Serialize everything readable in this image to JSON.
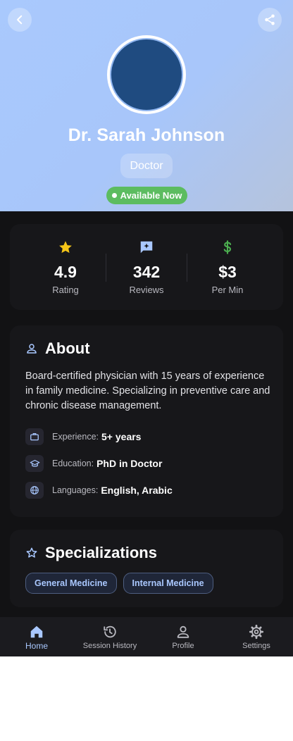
{
  "colors": {
    "header_gradient_start": "#a9c9fd",
    "header_gradient_end": "#b5c3dc",
    "avatar": "#1f4b80",
    "available": "#5cbc60",
    "star": "#f5c518",
    "dollar": "#4caf50",
    "accent": "#a9c8ff",
    "background": "#121214",
    "card": "#17171a"
  },
  "header": {
    "back_icon": "chevron-left-icon",
    "share_icon": "share-icon",
    "name": "Dr. Sarah Johnson",
    "role": "Doctor",
    "availability": "Available Now"
  },
  "stats": [
    {
      "icon": "star-icon",
      "value": "4.9",
      "label": "Rating"
    },
    {
      "icon": "review-icon",
      "value": "342",
      "label": "Reviews"
    },
    {
      "icon": "dollar-icon",
      "value": "$3",
      "label": "Per Min"
    }
  ],
  "about": {
    "icon": "person-icon",
    "title": "About",
    "text": "Board-certified physician with 15 years of experience in family medicine. Specializing in preventive care and chronic disease management.",
    "details": [
      {
        "icon": "briefcase-icon",
        "label": "Experience:",
        "value": "5+ years"
      },
      {
        "icon": "graduation-cap-icon",
        "label": "Education:",
        "value": "PhD in Doctor"
      },
      {
        "icon": "globe-icon",
        "label": "Languages:",
        "value": "English, Arabic"
      }
    ]
  },
  "specializations": {
    "icon": "star-outline-icon",
    "title": "Specializations",
    "items": [
      "General Medicine",
      "Internal Medicine"
    ]
  },
  "nav": {
    "items": [
      {
        "icon": "home-icon",
        "label": "Home",
        "active": true
      },
      {
        "icon": "history-icon",
        "label": "Session History",
        "active": false
      },
      {
        "icon": "profile-icon",
        "label": "Profile",
        "active": false
      },
      {
        "icon": "settings-icon",
        "label": "Settings",
        "active": false
      }
    ]
  }
}
